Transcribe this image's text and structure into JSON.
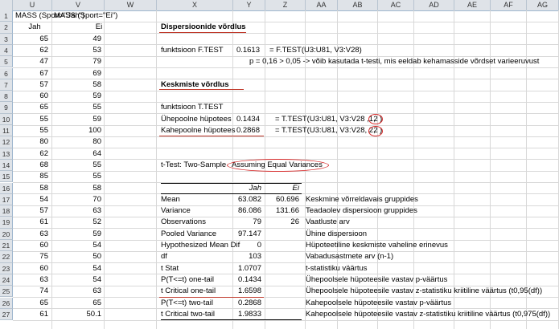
{
  "columns": [
    "U",
    "V",
    "W",
    "X",
    "Y",
    "Z",
    "AA",
    "AB",
    "AC",
    "AD",
    "AE",
    "AF",
    "AG"
  ],
  "rows": [
    "1",
    "2",
    "3",
    "4",
    "5",
    "6",
    "7",
    "8",
    "9",
    "10",
    "11",
    "12",
    "13",
    "14",
    "15",
    "16",
    "17",
    "18",
    "19",
    "20",
    "21",
    "22",
    "23",
    "24",
    "25",
    "26",
    "27"
  ],
  "row1_label": "MASS (Sport=\"Jah\")",
  "row1_label_v": "MASS (Sport=\"Ei\")",
  "jah_header": "Jah",
  "ei_header": "Ei",
  "jah_values": [
    "65",
    "62",
    "47",
    "67",
    "57",
    "60",
    "65",
    "55",
    "55",
    "80",
    "62",
    "68",
    "85",
    "58",
    "54",
    "57",
    "61",
    "63",
    "60",
    "75",
    "60",
    "63",
    "74",
    "65",
    "61"
  ],
  "ei_values": [
    "49",
    "53",
    "79",
    "69",
    "58",
    "59",
    "55",
    "59",
    "100",
    "80",
    "64",
    "55",
    "55",
    "58",
    "70",
    "63",
    "52",
    "59",
    "54",
    "50",
    "54",
    "54",
    "63",
    "65",
    "50.1"
  ],
  "dispersion_title": "Dispersioonide võrdlus",
  "ftest_label": "funktsioon F.TEST",
  "ftest_value": "0.1613",
  "ftest_formula": "= F.TEST(U3:U81, V3:V28)",
  "ftest_note": "p = 0,16 > 0,05 -> võib kasutada t-testi, mis eeldab kehamasside võrdset varieeruvust",
  "means_title": "Keskmiste võrdlus",
  "ttest_label": "funktsioon T.TEST",
  "onetail_label": "Ühepoolne hüpotees",
  "onetail_value": "0.1434",
  "onetail_formula": "= T.TEST(U3:U81, V3:V28 ,1,",
  "onetail_circ": "2",
  "onetail_end": ")",
  "twotail_label": "Kahepoolne hüpotees",
  "twotail_value": "0.2868",
  "twotail_formula": "= T.TEST(U3:U81, V3:V28, 2,",
  "twotail_circ": "2",
  "twotail_end": ")",
  "ttest_title_a": "t-Test: Two-Sample",
  "ttest_title_b": "Assuming Equal Variances",
  "table": {
    "col_jah": "Jah",
    "col_ei": "Ei",
    "rows": [
      {
        "label": "Mean",
        "jah": "63.082",
        "ei": "60.696",
        "note": "Keskmine võrreldavais gruppides"
      },
      {
        "label": "Variance",
        "jah": "86.086",
        "ei": "131.66",
        "note": "Teadaolev dispersioon gruppides"
      },
      {
        "label": "Observations",
        "jah": "79",
        "ei": "26",
        "note": "Vaatluste arv"
      },
      {
        "label": "Pooled Variance",
        "jah": "97.147",
        "ei": "",
        "note": "Ühine dispersioon"
      },
      {
        "label": "Hypothesized Mean Dif",
        "jah": "0",
        "ei": "",
        "note": "Hüpoteetiline keskmiste vaheline erinevus"
      },
      {
        "label": "df",
        "jah": "103",
        "ei": "",
        "note": "Vabadusastmete arv (n-1)"
      },
      {
        "label": "t Stat",
        "jah": "1.0707",
        "ei": "",
        "note": "t-statistiku väärtus"
      },
      {
        "label": "P(T<=t) one-tail",
        "jah": "0.1434",
        "ei": "",
        "note": "Ühepoolsele hüpoteesile vastav p-väärtus"
      },
      {
        "label": "t Critical one-tail",
        "jah": "1.6598",
        "ei": "",
        "note": "Ühepoolsele hüpoteesile vastav z-statistiku kriitiline väärtus (t0,95(df))"
      },
      {
        "label": "P(T<=t) two-tail",
        "jah": "0.2868",
        "ei": "",
        "note": "Kahepoolsele hüpoteesile vastav p-väärtus"
      },
      {
        "label": "t Critical two-tail",
        "jah": "1.9833",
        "ei": "",
        "note": "Kahepoolsele hüpoteesile vastav z-statistiku kriitiline väärtus (t0,975(df))"
      }
    ]
  },
  "colors": {
    "header_bg": "#dfe3e8",
    "grid": "#d8d8d8",
    "red": "#d62a2a"
  }
}
